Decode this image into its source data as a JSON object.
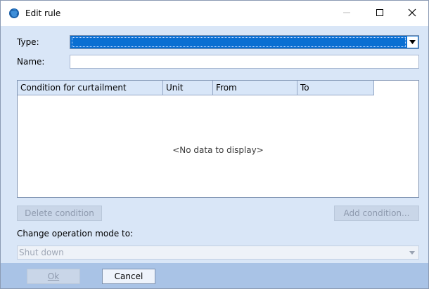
{
  "window": {
    "title": "Edit rule",
    "minimize_icon": "minimize-icon",
    "maximize_icon": "maximize-icon",
    "close_icon": "close-icon"
  },
  "form": {
    "type_label": "Type:",
    "type_value": "",
    "name_label": "Name:",
    "name_value": ""
  },
  "grid": {
    "columns": [
      "Condition for curtailment",
      "Unit",
      "From",
      "To"
    ],
    "rows": [],
    "empty_text": "<No data to display>"
  },
  "buttons": {
    "delete_condition": "Delete condition",
    "add_condition": "Add condition...",
    "ok": "Ok",
    "cancel": "Cancel"
  },
  "mode": {
    "label": "Change operation mode to:",
    "value": "Shut down"
  },
  "colors": {
    "body_bg": "#d9e6f7",
    "footer_bg": "#a9c3e6",
    "select_highlight": "#0a6fd2"
  }
}
